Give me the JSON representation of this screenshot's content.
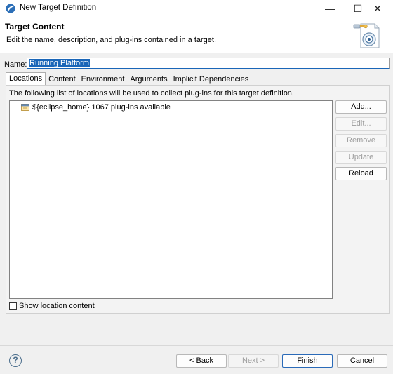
{
  "window": {
    "title": "New Target Definition",
    "minimize_glyph": "—",
    "maximize_glyph": "☐",
    "close_glyph": "✕"
  },
  "header": {
    "title": "Target Content",
    "description": "Edit the name, description, and plug-ins contained in a target.",
    "icon": "target-definition-wizard-icon"
  },
  "name_field": {
    "label": "Name:",
    "value": "Running Platform"
  },
  "tabs": [
    "Locations",
    "Content",
    "Environment",
    "Arguments",
    "Implicit Dependencies"
  ],
  "active_tab": "Locations",
  "locations": {
    "description": "The following list of locations will be used to collect plug-ins for this target definition.",
    "items": [
      {
        "label": "${eclipse_home} 1067 plug-ins available",
        "icon": "installation-folder-icon"
      }
    ],
    "buttons": {
      "add": "Add...",
      "edit": "Edit...",
      "remove": "Remove",
      "update": "Update",
      "reload": "Reload"
    },
    "show_content_label": "Show location content",
    "show_content_checked": false
  },
  "footer": {
    "help_glyph": "?",
    "back": "< Back",
    "next": "Next >",
    "finish": "Finish",
    "cancel": "Cancel"
  },
  "colors": {
    "accent": "#1a66b8",
    "dialog_bg": "#f0f0f0",
    "disabled_text": "#9c9c9c"
  }
}
